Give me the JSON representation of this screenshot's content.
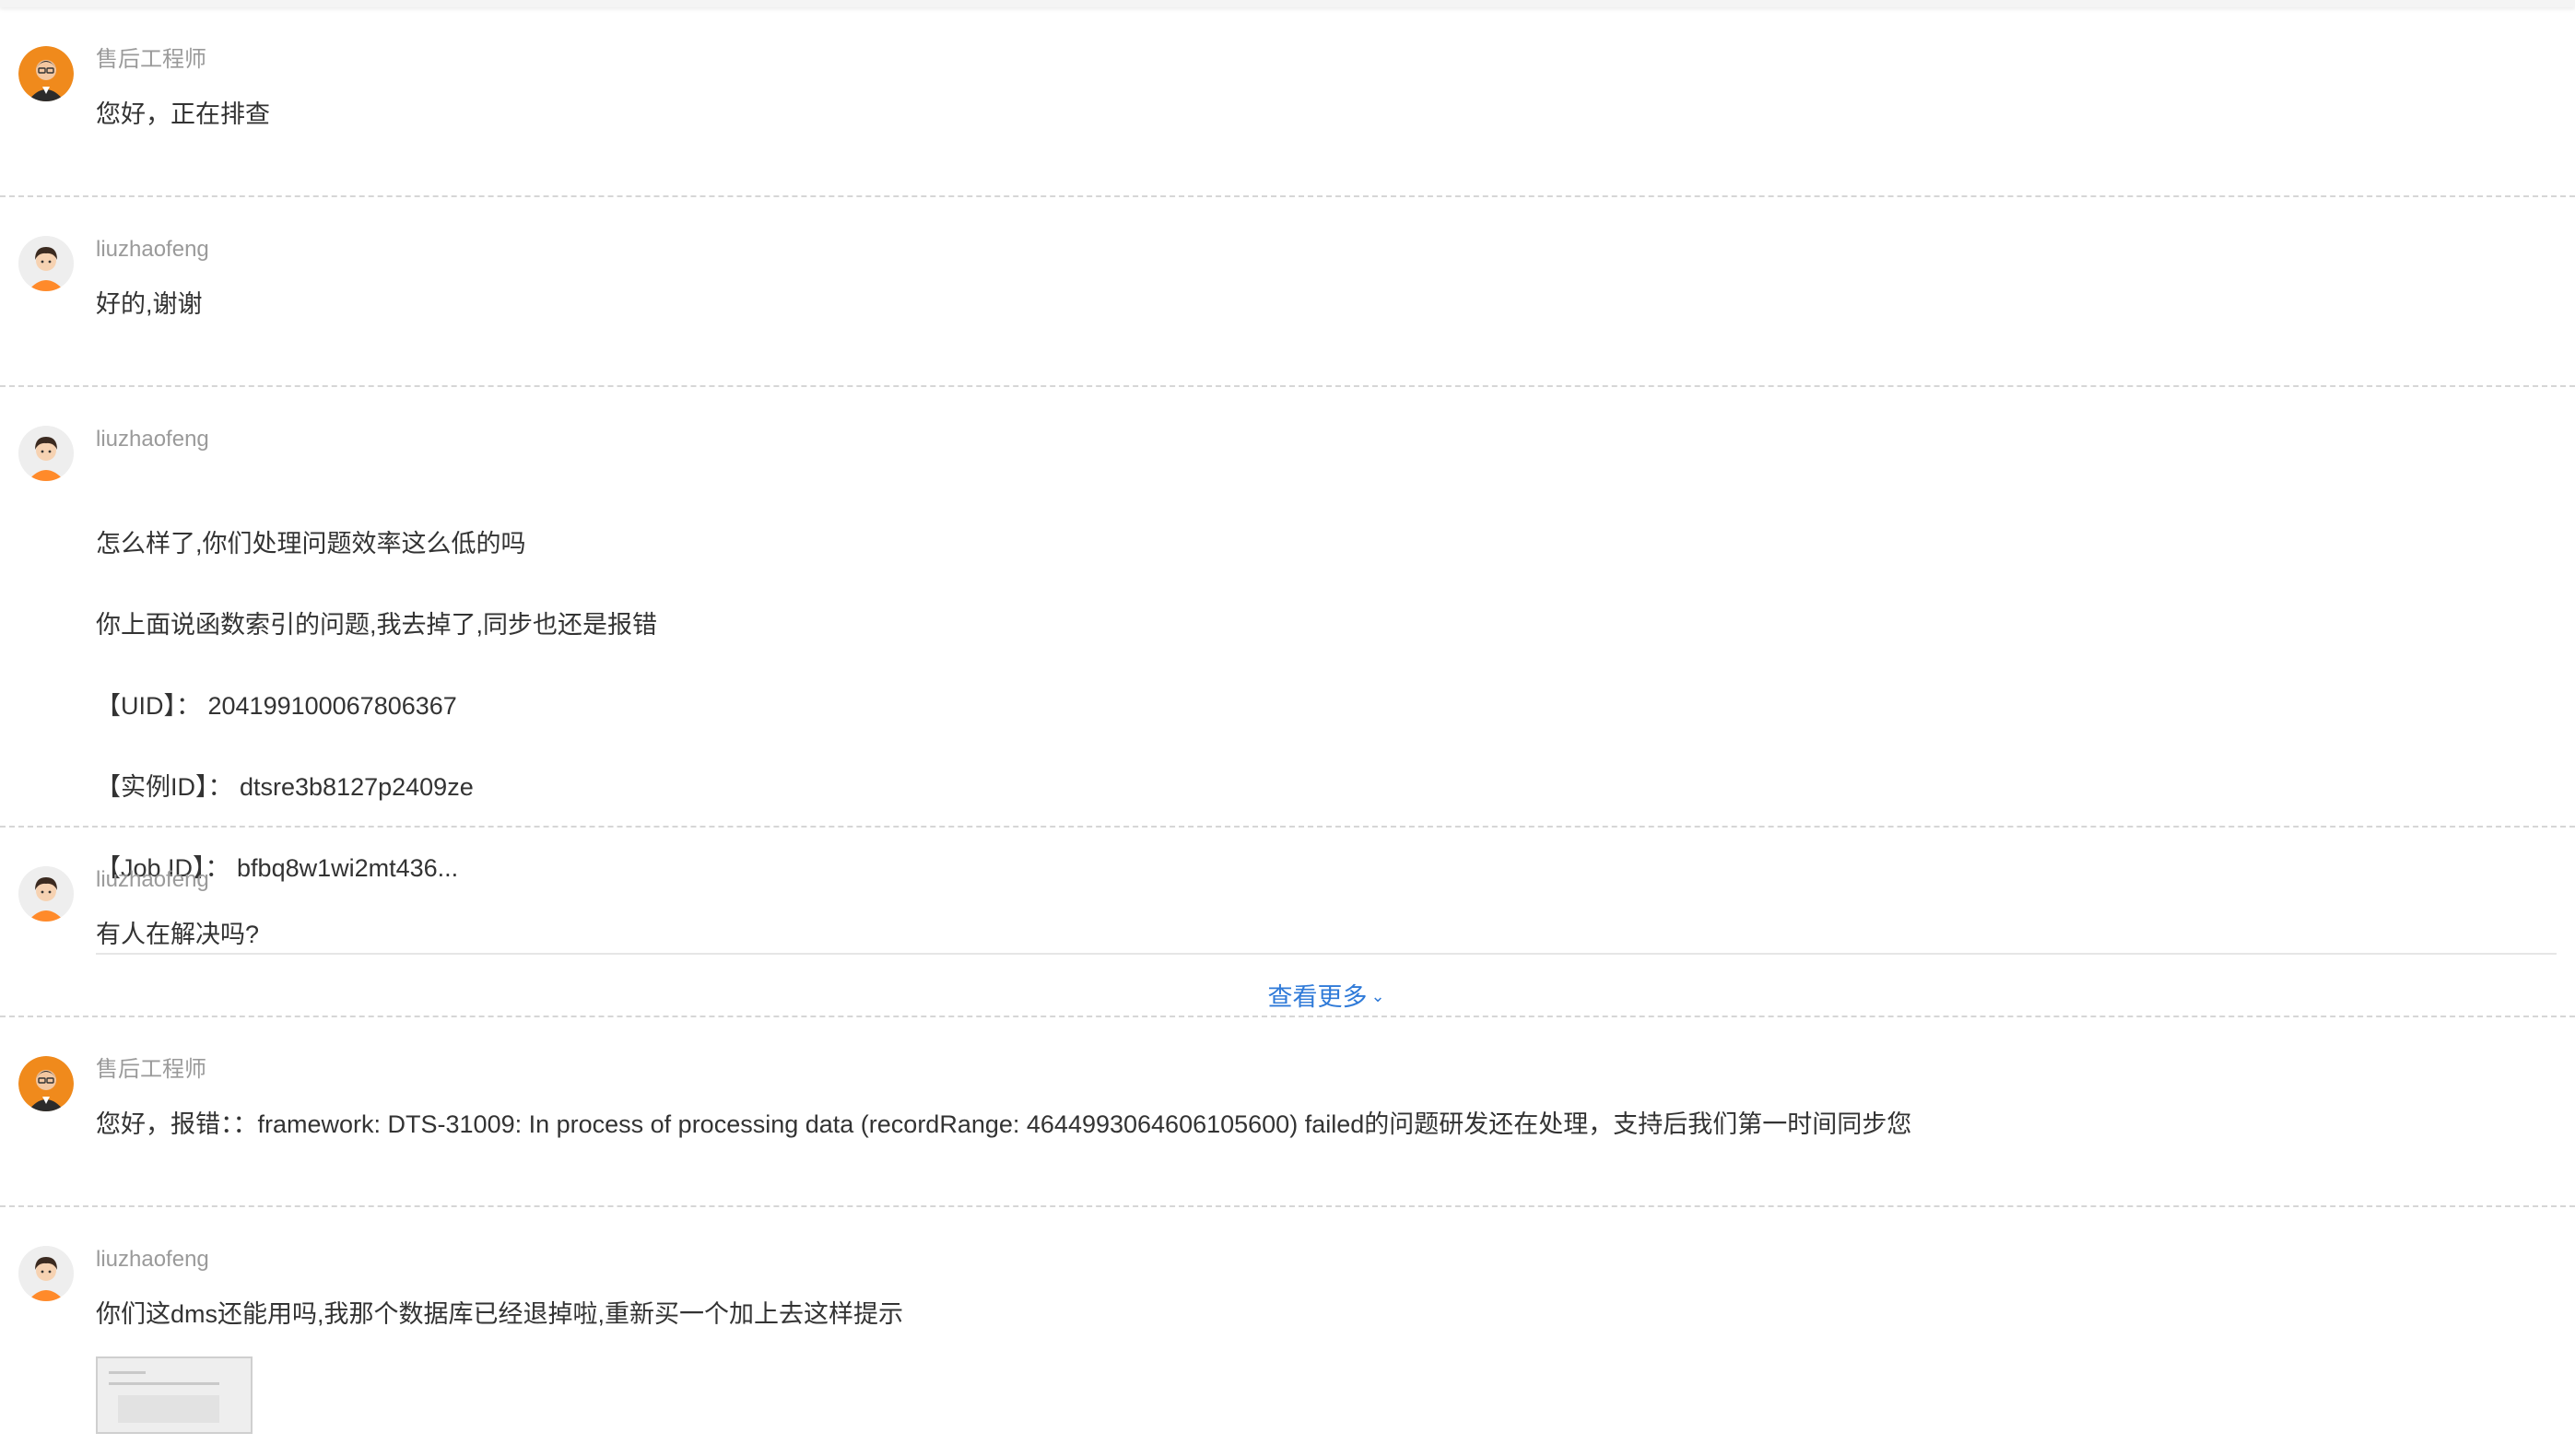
{
  "messages": [
    {
      "author": "售后工程师",
      "role": "engineer",
      "lines": [
        "您好，正在排查"
      ]
    },
    {
      "author": "liuzhaofeng",
      "role": "user",
      "lines": [
        "好的,谢谢"
      ]
    },
    {
      "author": "liuzhaofeng",
      "role": "user",
      "lines": [
        "怎么样了,你们处理问题效率这么低的吗",
        "你上面说函数索引的问题,我去掉了,同步也还是报错",
        "【UID】： 204199100067806367",
        "【实例ID】： dtsre3b8127p2409ze",
        "【Job ID】： bfbq8w1wi2mt436..."
      ],
      "more_label": "查看更多"
    },
    {
      "author": "liuzhaofeng",
      "role": "user",
      "lines": [
        "有人在解决吗?"
      ]
    },
    {
      "author": "售后工程师",
      "role": "engineer",
      "lines": [
        "您好，报错：：framework: DTS-31009: In process of processing data (recordRange: 4644993064606105600) failed的问题研发还在处理，支持后我们第一时间同步您"
      ]
    },
    {
      "author": "liuzhaofeng",
      "role": "user",
      "lines": [
        "你们这dms还能用吗,我那个数据库已经退掉啦,重新买一个加上去这样提示"
      ],
      "has_image": true
    }
  ],
  "colors": {
    "link": "#2f7ad8",
    "author": "#9a9a9a",
    "text": "#333333",
    "engineer_avatar": "#f08a1c",
    "user_avatar_shirt": "#ff8a2a"
  }
}
